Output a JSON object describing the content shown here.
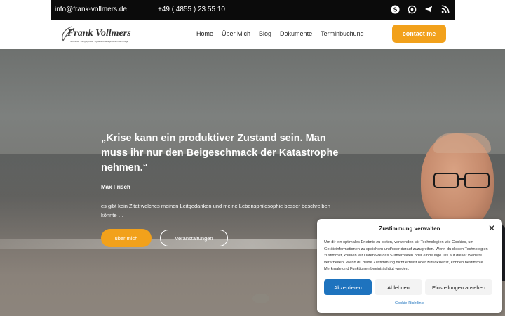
{
  "topbar": {
    "email": "info@frank-vollmers.de",
    "phone": "+49 ( 4855 ) 23 55 10",
    "social_icons": [
      "skype-icon",
      "whatsapp-icon",
      "telegram-icon",
      "rss-icon"
    ]
  },
  "header": {
    "logo_name": "Frank Vollmers",
    "logo_tagline": "Journalist · Bürgerpoliker · Qualitätsmanagement in der Pflege",
    "nav": [
      "Home",
      "Über Mich",
      "Blog",
      "Dokumente",
      "Terminbuchung"
    ],
    "cta": "contact me"
  },
  "hero": {
    "quote": "„Krise kann ein produktiver Zustand sein. Man muss ihr nur den Beigeschmack der Katastrophe nehmen.“",
    "author": "Max Frisch",
    "description": "es gibt kein Zitat welches meinen Leitgedanken und meine Lebensphilosophie besser beschreiben könnte …",
    "btn_about": "über mich",
    "btn_events": "Veranstaltungen"
  },
  "consent": {
    "title": "Zustimmung verwalten",
    "text": "Um dir ein optimales Erlebnis zu bieten, verwenden wir Technologien wie Cookies, um Geräteinformationen zu speichern und/oder darauf zuzugreifen. Wenn du diesen Technologien zustimmst, können wir Daten wie das Surfverhalten oder eindeutige IDs auf dieser Website verarbeiten. Wenn du deine Zustimmung nicht erteilst oder zurückziehst, können bestimmte Merkmale und Funktionen beeinträchtigt werden.",
    "accept": "Akzeptieren",
    "deny": "Ablehnen",
    "settings": "Einstellungen ansehen",
    "policy": "Cookie-Richtlinie"
  },
  "colors": {
    "accent": "#f2a11b",
    "primary_button": "#1e73be",
    "topbar": "#0b0b0b"
  }
}
